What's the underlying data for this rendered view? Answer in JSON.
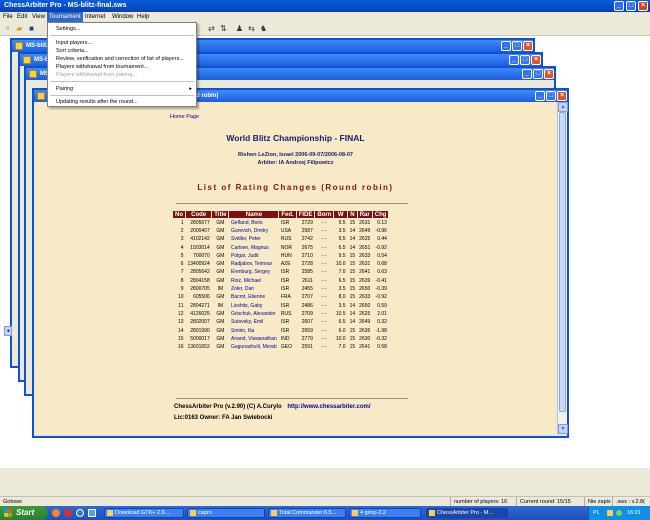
{
  "app": {
    "title": "ChessArbiter Pro - MS-blitz-final.sws"
  },
  "menu": [
    "File",
    "Edit",
    "View",
    "Tournament",
    "Internet",
    "Window",
    "Help"
  ],
  "dropdown": {
    "items": [
      {
        "label": "Settings...",
        "enabled": true
      },
      {
        "label": "Input players...",
        "enabled": true
      },
      {
        "label": "Sort criteria...",
        "enabled": true
      },
      {
        "label": "Review, verification and correction of list of players...",
        "enabled": true
      },
      {
        "label": "Players withdrawal from tournament...",
        "enabled": true
      },
      {
        "label": "Players withdrawal from pairing...",
        "enabled": false
      },
      {
        "label": "Pairing",
        "enabled": true,
        "submenu": true
      },
      {
        "label": "Updating results after the round...",
        "enabled": true
      }
    ]
  },
  "windows": {
    "back1_title": "MS-blitz-f",
    "back2_title": "MS-blitz-",
    "back3_title": "MS",
    "front_title_tail": "d robin)"
  },
  "page": {
    "home_link": "Home Page",
    "heading": "World Blitz Championship - FINAL",
    "place": "Rishon LeZion, Israel 2006-09-07/2006-08-07",
    "arbiter": "Arbiter: IA Andrzej Filipowicz",
    "list_title": "List of Rating Changes (Round robin)",
    "footer_line1": "ChessArbiter Pro (v.2.90) (C) A.Curylo",
    "footer_link": "http://www.chessarbiter.com/",
    "footer_line2": "Lic:0163 Owner: FA Jan Swiebocki"
  },
  "table": {
    "headers": [
      "No",
      "Code",
      "Title",
      "Name",
      "Fed.",
      "FIDE",
      "Born",
      "W",
      "N",
      "Rar",
      "Chg"
    ],
    "rows": [
      [
        "1",
        "2805677",
        "GM",
        "Gelfand, Boris",
        "ISR",
        "2729",
        "- -",
        "9.5",
        "15",
        "2631",
        "0.13"
      ],
      [
        "2",
        "2000407",
        "GM",
        "Gurevich, Dmitry",
        "USA",
        "2587",
        "- -",
        "3.5",
        "14",
        "2649",
        "-0.96"
      ],
      [
        "3",
        "4102142",
        "GM",
        "Svidler, Peter",
        "RUS",
        "2742",
        "- -",
        "9.5",
        "14",
        "2625",
        "0.44"
      ],
      [
        "4",
        "1503014",
        "GM",
        "Carlsen, Magnus",
        "NOR",
        "2675",
        "- -",
        "6.5",
        "14",
        "2651",
        "-0.92"
      ],
      [
        "5",
        "700070",
        "GM",
        "Polgar, Judit",
        "HUN",
        "2710",
        "- -",
        "9.5",
        "15",
        "2633",
        "0.54"
      ],
      [
        "6",
        "13400924",
        "GM",
        "Radjabov, Teimour",
        "AZE",
        "2728",
        "- -",
        "10.0",
        "15",
        "2631",
        "0.68"
      ],
      [
        "7",
        "2805642",
        "GM",
        "Erenburg, Sergey",
        "ISR",
        "2585",
        "- -",
        "7.0",
        "15",
        "2641",
        "0.63"
      ],
      [
        "8",
        "2804158",
        "GM",
        "Roiz, Michael",
        "ISR",
        "2611",
        "- -",
        "6.5",
        "15",
        "2639",
        "-0.41"
      ],
      [
        "9",
        "2800705",
        "IM",
        "Zoler, Dan",
        "ISR",
        "2455",
        "- -",
        "3.5",
        "15",
        "2650",
        "-0.39"
      ],
      [
        "10",
        "605506",
        "GM",
        "Bacrot, Etienne",
        "FRA",
        "2707",
        "- -",
        "8.0",
        "15",
        "2633",
        "-0.92"
      ],
      [
        "11",
        "2804271",
        "IM",
        "Livshits, Gaby",
        "ISR",
        "2486",
        "- -",
        "3.5",
        "14",
        "2650",
        "0.59"
      ],
      [
        "12",
        "4126025",
        "GM",
        "Grischuk, Alexander",
        "RUS",
        "2709",
        "- -",
        "10.5",
        "14",
        "2625",
        "2.01"
      ],
      [
        "13",
        "2802007",
        "GM",
        "Sutovsky, Emil",
        "ISR",
        "2607",
        "- -",
        "6.5",
        "14",
        "2649",
        "0.32"
      ],
      [
        "14",
        "2801990",
        "GM",
        "Smirin, Ilia",
        "ISR",
        "2659",
        "- -",
        "6.0",
        "15",
        "2636",
        "-1.98"
      ],
      [
        "15",
        "5000017",
        "GM",
        "Anand, Viswanathan",
        "IND",
        "2779",
        "- -",
        "10.0",
        "15",
        "2630",
        "-0.32"
      ],
      [
        "16",
        "13601652",
        "GM",
        "Gagunashvili, Merab",
        "GEO",
        "2591",
        "- -",
        "7.0",
        "15",
        "2641",
        "0.58"
      ]
    ]
  },
  "status": {
    "left": "Gotowe",
    "players": "number of players: 16",
    "round": "Current round: 15/15",
    "nie": "Nie zapis",
    "ext": ".sws : v.2.8("
  },
  "taskbar": {
    "start": "Start",
    "tasks": [
      "Download GTK+ 2.6....",
      "capro",
      "Total Commander 6.5...",
      "4 gimp-2.2",
      "ChessArbiter Pro - M..."
    ],
    "lang": "PL",
    "clock": "16:01"
  },
  "colors": {
    "content_bg": "#f8eac6",
    "header_bg": "#7b1111",
    "heading_color": "#1a1a6e",
    "list_title_color": "#8b1010",
    "link": "#00009c"
  }
}
